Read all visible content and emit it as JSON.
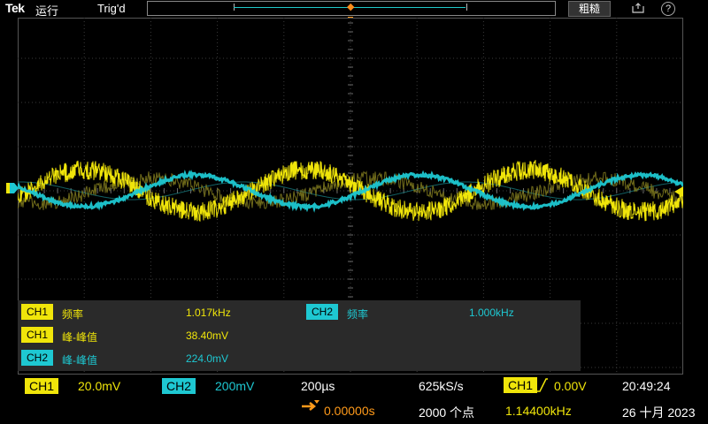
{
  "topbar": {
    "brand": "Tek",
    "run_state": "运行",
    "trigger_state": "Trig'd",
    "fine_button": "粗糙",
    "help_glyph": "?"
  },
  "colors": {
    "ch1": "#f0e50a",
    "ch2": "#1ec8d2",
    "accent": "#ff9a1a",
    "panel": "#2a2a2a"
  },
  "screen": {
    "trigger_marker_label": "T",
    "ch1_marker": "1",
    "ch2_marker": "2"
  },
  "measurements": [
    {
      "channel": "CH1",
      "label": "频率",
      "value": "1.017kHz"
    },
    {
      "channel": "CH2",
      "label": "频率",
      "value": "1.000kHz"
    },
    {
      "channel": "CH1",
      "label": "峰-峰值",
      "value": "38.40mV"
    },
    {
      "channel": "CH2",
      "label": "峰-峰值",
      "value": "224.0mV"
    }
  ],
  "bottom": {
    "ch1_tag": "CH1",
    "ch1_scale": "20.0mV",
    "ch2_tag": "CH2",
    "ch2_scale": "200mV",
    "timebase": "200µs",
    "sample_rate": "625kS/s",
    "trig_tag": "CH1",
    "trig_level": "0.00V",
    "time": "20:49:24",
    "position": "0.00000s",
    "record_length": "2000 个点",
    "trig_freq": "1.14400kHz",
    "date": "26 十月 2023"
  }
}
